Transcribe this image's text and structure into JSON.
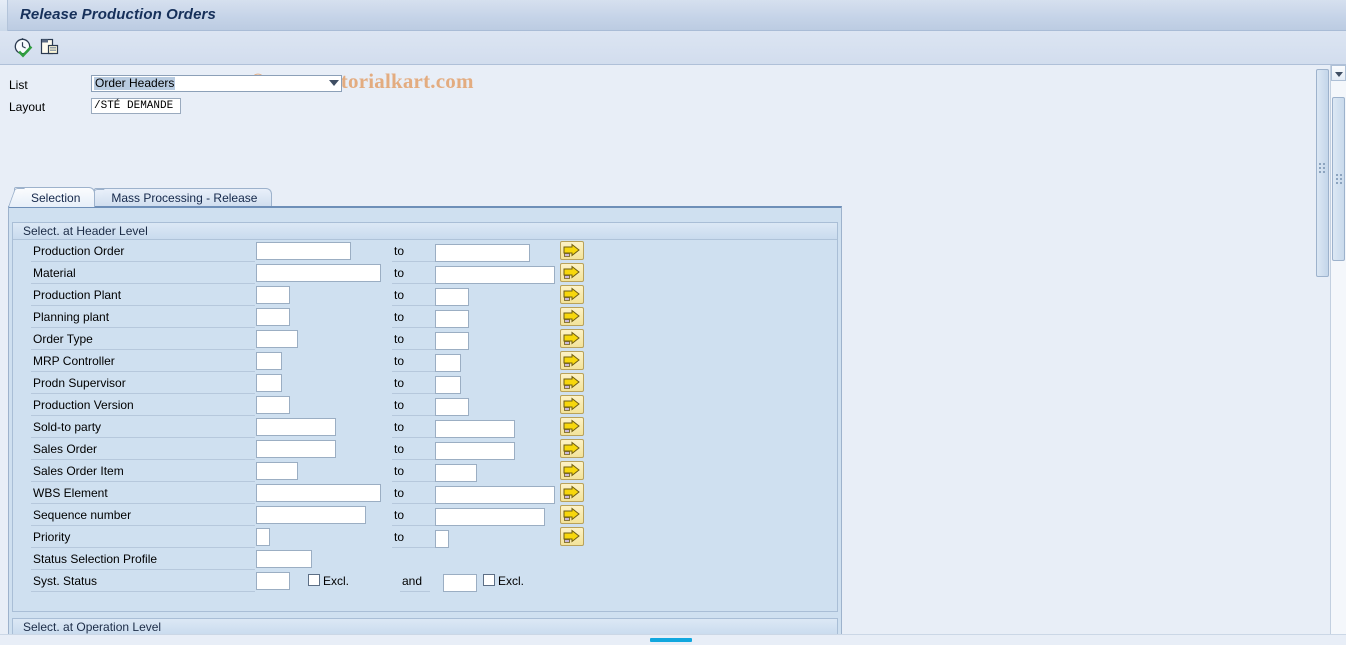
{
  "window": {
    "title": "Release Production Orders"
  },
  "toolbar": {
    "icons": [
      {
        "name": "execute-clock-check-icon",
        "label": "Execute"
      },
      {
        "name": "multiple-selection-copy-icon",
        "label": "Multiple Selection"
      }
    ],
    "watermark": "© www.tutorialkart.com"
  },
  "selection_header": {
    "list_label": "List",
    "list_value": "Order Headers",
    "layout_label": "Layout",
    "layout_value": "/STÉ DEMANDE"
  },
  "tabs": [
    {
      "label": "Selection",
      "selected": true
    },
    {
      "label": "Mass Processing - Release",
      "selected": false
    }
  ],
  "groups": {
    "header_level": {
      "title": "Select. at Header Level",
      "to_label": "to",
      "and_label": "and",
      "excl_label": "Excl.",
      "rows": [
        {
          "label": "Production Order",
          "from": "",
          "to": "",
          "from_w": "w95",
          "to_w": "w95",
          "arrow": true
        },
        {
          "label": "Material",
          "from": "",
          "to": "",
          "from_w": "w125",
          "to_w": "w120",
          "arrow": true
        },
        {
          "label": "Production Plant",
          "from": "",
          "to": "",
          "from_w": "w34",
          "to_w": "w34",
          "arrow": true
        },
        {
          "label": "Planning plant",
          "from": "",
          "to": "",
          "from_w": "w34",
          "to_w": "w34",
          "arrow": true
        },
        {
          "label": "Order Type",
          "from": "",
          "to": "",
          "from_w": "w42",
          "to_w": "w34",
          "arrow": true
        },
        {
          "label": "MRP Controller",
          "from": "",
          "to": "",
          "from_w": "w26",
          "to_w": "w26",
          "arrow": true
        },
        {
          "label": "Prodn Supervisor",
          "from": "",
          "to": "",
          "from_w": "w26",
          "to_w": "w26",
          "arrow": true
        },
        {
          "label": "Production Version",
          "from": "",
          "to": "",
          "from_w": "w34",
          "to_w": "w34",
          "arrow": true
        },
        {
          "label": "Sold-to party",
          "from": "",
          "to": "",
          "from_w": "w80",
          "to_w": "w80",
          "arrow": true
        },
        {
          "label": "Sales Order",
          "from": "",
          "to": "",
          "from_w": "w80",
          "to_w": "w80",
          "arrow": true
        },
        {
          "label": "Sales Order Item",
          "from": "",
          "to": "",
          "from_w": "w42",
          "to_w": "w42",
          "arrow": true
        },
        {
          "label": "WBS Element",
          "from": "",
          "to": "",
          "from_w": "w125",
          "to_w": "w120",
          "arrow": true
        },
        {
          "label": "Sequence number",
          "from": "",
          "to": "",
          "from_w": "w110",
          "to_w": "w110",
          "arrow": true
        },
        {
          "label": "Priority",
          "from": "",
          "to": "",
          "from_w": "w14",
          "to_w": "w14",
          "arrow": true
        }
      ],
      "status_profile": {
        "label": "Status Selection Profile",
        "value": ""
      },
      "syst_status": {
        "label": "Syst. Status",
        "value1": "",
        "excl1": false,
        "value2": "",
        "excl2": false
      }
    },
    "operation_level": {
      "title": "Select. at Operation Level"
    }
  },
  "colors": {
    "background": "#E8EEF7",
    "panel": "#CFE0F0",
    "title_text": "#16305A",
    "watermark": "#E3AC80",
    "arrow_button": "#F3E39A",
    "accent": "#11A7DE"
  }
}
